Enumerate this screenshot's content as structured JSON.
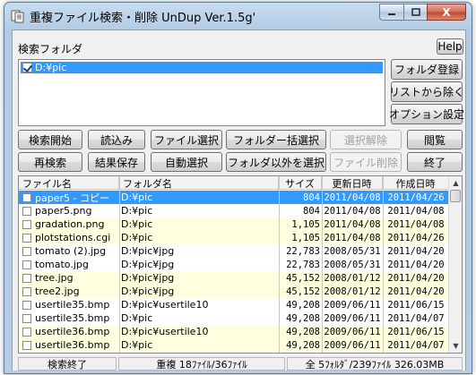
{
  "window": {
    "title": "重複ファイル検索・削除  UnDup Ver.1.5g'",
    "close_glyph": "X"
  },
  "folder_section": {
    "label": "検索フォルダ",
    "help_label": "Help",
    "folders": [
      {
        "path": "D:¥pic",
        "checked": true
      }
    ]
  },
  "side_buttons": {
    "register_folder": "フォルダ登録",
    "remove_from_list": "リストから除く",
    "option_settings": "オプション設定"
  },
  "toolbar_row1": {
    "start_search": "検索開始",
    "load": "読込み",
    "select_files": "ファイル選択",
    "select_folder_all": "フォルダー括選択",
    "deselect": "選択解除",
    "browse": "閲覧"
  },
  "toolbar_row2": {
    "research": "再検索",
    "save_results": "結果保存",
    "auto_select": "自動選択",
    "select_except_folder": "フォルダ以外を選択",
    "delete_files": "ファイル削除",
    "exit": "終了"
  },
  "results": {
    "columns": {
      "name": "ファイル名",
      "folder": "フォルダ名",
      "size": "サイズ",
      "modified": "更新日時",
      "created": "作成日時"
    },
    "rows": [
      {
        "name": "paper5 - コピー",
        "folder": "D:¥pic",
        "size": "804",
        "modified": "2011/04/08",
        "created": "2011/04/26",
        "checked": false,
        "style": "sel"
      },
      {
        "name": "paper5.png",
        "folder": "D:¥pic",
        "size": "804",
        "modified": "2011/04/08",
        "created": "2011/04/08",
        "checked": false,
        "style": "white"
      },
      {
        "name": "gradation.png",
        "folder": "D:¥pic",
        "size": "1,105",
        "modified": "2011/04/08",
        "created": "2011/04/08",
        "checked": false,
        "style": "yellow"
      },
      {
        "name": "plotstations.cgi",
        "folder": "D:¥pic",
        "size": "1,105",
        "modified": "2011/04/08",
        "created": "2011/04/26",
        "checked": false,
        "style": "yellow"
      },
      {
        "name": "tomato (2).jpg",
        "folder": "D:¥pic¥jpg",
        "size": "22,783",
        "modified": "2008/05/31",
        "created": "2011/04/20",
        "checked": false,
        "style": "white"
      },
      {
        "name": "tomato.jpg",
        "folder": "D:¥pic¥jpg",
        "size": "22,783",
        "modified": "2008/05/31",
        "created": "2011/04/20",
        "checked": false,
        "style": "white"
      },
      {
        "name": "tree.jpg",
        "folder": "D:¥pic¥jpg",
        "size": "45,152",
        "modified": "2008/01/12",
        "created": "2011/04/20",
        "checked": false,
        "style": "yellow"
      },
      {
        "name": "tree2.jpg",
        "folder": "D:¥pic¥jpg",
        "size": "45,152",
        "modified": "2008/01/12",
        "created": "2011/04/20",
        "checked": false,
        "style": "yellow"
      },
      {
        "name": "usertile35.bmp",
        "folder": "D:¥pic¥usertile10",
        "size": "49,208",
        "modified": "2009/06/11",
        "created": "2011/06/15",
        "checked": false,
        "style": "white"
      },
      {
        "name": "usertile35.bmp",
        "folder": "D:¥pic",
        "size": "49,208",
        "modified": "2009/06/11",
        "created": "2011/04/07",
        "checked": false,
        "style": "white"
      },
      {
        "name": "usertile36.bmp",
        "folder": "D:¥pic¥usertile10",
        "size": "49,208",
        "modified": "2009/06/11",
        "created": "2011/06/15",
        "checked": false,
        "style": "yellow"
      },
      {
        "name": "usertile36.bmp",
        "folder": "D:¥pic",
        "size": "49,208",
        "modified": "2009/06/11",
        "created": "2011/04/07",
        "checked": false,
        "style": "yellow"
      }
    ]
  },
  "status_bar": {
    "state": "検索終了",
    "duplicates": "重複 18ﾌｧｲﾙ/36ﾌｧｲﾙ",
    "totals": "全 5ﾌｫﾙﾀﾞ/239ﾌｧｲﾙ 326.03MB"
  },
  "colors": {
    "selection": "#3399ff",
    "duplicate_group_alt": "#ffffe0",
    "window_frame": "#b8cde3",
    "close_button": "#c2452b"
  }
}
